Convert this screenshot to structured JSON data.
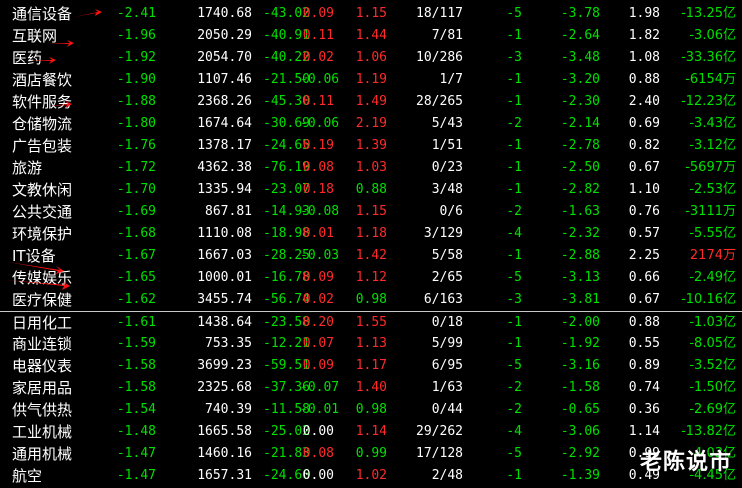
{
  "colors": {
    "up": "#ff2a2a",
    "down": "#00e000",
    "neutral": "#ffffff",
    "background": "#000000"
  },
  "watermark": "老陈说市",
  "rows": [
    {
      "name": "通信设备",
      "change": "-2.41",
      "price": "1740.68",
      "delta": "-43.02",
      "speed": "0.09",
      "ratio": "1.15",
      "updown": "18/117",
      "col7": "-5",
      "col8": "-3.78",
      "col9": "1.98",
      "amount": "-13.25亿",
      "speed_dir": "up",
      "ratio_dir": "up",
      "amount_dir": "down"
    },
    {
      "name": "互联网",
      "change": "-1.96",
      "price": "2050.29",
      "delta": "-40.91",
      "speed": "0.11",
      "ratio": "1.44",
      "updown": "7/81",
      "col7": "-1",
      "col8": "-2.64",
      "col9": "1.82",
      "amount": "-3.06亿",
      "speed_dir": "up",
      "ratio_dir": "up",
      "amount_dir": "down"
    },
    {
      "name": "医药",
      "change": "-1.92",
      "price": "2054.70",
      "delta": "-40.22",
      "speed": "0.02",
      "ratio": "1.06",
      "updown": "10/286",
      "col7": "-3",
      "col8": "-3.48",
      "col9": "1.08",
      "amount": "-33.36亿",
      "speed_dir": "up",
      "ratio_dir": "up",
      "amount_dir": "down"
    },
    {
      "name": "酒店餐饮",
      "change": "-1.90",
      "price": "1107.46",
      "delta": "-21.50",
      "speed": "-0.06",
      "ratio": "1.19",
      "updown": "1/7",
      "col7": "-1",
      "col8": "-3.20",
      "col9": "0.88",
      "amount": "-6154万",
      "speed_dir": "down",
      "ratio_dir": "up",
      "amount_dir": "down"
    },
    {
      "name": "软件服务",
      "change": "-1.88",
      "price": "2368.26",
      "delta": "-45.30",
      "speed": "0.11",
      "ratio": "1.49",
      "updown": "28/265",
      "col7": "-1",
      "col8": "-2.30",
      "col9": "2.40",
      "amount": "-12.23亿",
      "speed_dir": "up",
      "ratio_dir": "up",
      "amount_dir": "down"
    },
    {
      "name": "仓储物流",
      "change": "-1.80",
      "price": "1674.64",
      "delta": "-30.69",
      "speed": "-0.06",
      "ratio": "2.19",
      "updown": "5/43",
      "col7": "-2",
      "col8": "-2.14",
      "col9": "0.69",
      "amount": "-3.43亿",
      "speed_dir": "down",
      "ratio_dir": "up",
      "amount_dir": "down"
    },
    {
      "name": "广告包装",
      "change": "-1.76",
      "price": "1378.17",
      "delta": "-24.65",
      "speed": "0.19",
      "ratio": "1.39",
      "updown": "1/51",
      "col7": "-1",
      "col8": "-2.78",
      "col9": "0.82",
      "amount": "-3.12亿",
      "speed_dir": "up",
      "ratio_dir": "up",
      "amount_dir": "down"
    },
    {
      "name": "旅游",
      "change": "-1.72",
      "price": "4362.38",
      "delta": "-76.19",
      "speed": "0.08",
      "ratio": "1.03",
      "updown": "0/23",
      "col7": "-1",
      "col8": "-2.50",
      "col9": "0.67",
      "amount": "-5697万",
      "speed_dir": "up",
      "ratio_dir": "up",
      "amount_dir": "down"
    },
    {
      "name": "文教休闲",
      "change": "-1.70",
      "price": "1335.94",
      "delta": "-23.07",
      "speed": "0.18",
      "ratio": "0.88",
      "updown": "3/48",
      "col7": "-1",
      "col8": "-2.82",
      "col9": "1.10",
      "amount": "-2.53亿",
      "speed_dir": "up",
      "ratio_dir": "down",
      "amount_dir": "down"
    },
    {
      "name": "公共交通",
      "change": "-1.69",
      "price": "867.81",
      "delta": "-14.93",
      "speed": "-0.08",
      "ratio": "1.15",
      "updown": "0/6",
      "col7": "-2",
      "col8": "-1.63",
      "col9": "0.76",
      "amount": "-3111万",
      "speed_dir": "down",
      "ratio_dir": "up",
      "amount_dir": "down"
    },
    {
      "name": "环境保护",
      "change": "-1.68",
      "price": "1110.08",
      "delta": "-18.98",
      "speed": "0.01",
      "ratio": "1.18",
      "updown": "3/129",
      "col7": "-4",
      "col8": "-2.32",
      "col9": "0.57",
      "amount": "-5.55亿",
      "speed_dir": "up",
      "ratio_dir": "up",
      "amount_dir": "down"
    },
    {
      "name": "IT设备",
      "change": "-1.67",
      "price": "1667.03",
      "delta": "-28.25",
      "speed": "-0.03",
      "ratio": "1.42",
      "updown": "5/58",
      "col7": "-1",
      "col8": "-2.88",
      "col9": "2.25",
      "amount": "2174万",
      "speed_dir": "down",
      "ratio_dir": "up",
      "amount_dir": "up"
    },
    {
      "name": "传媒娱乐",
      "change": "-1.65",
      "price": "1000.01",
      "delta": "-16.78",
      "speed": "0.09",
      "ratio": "1.12",
      "updown": "2/65",
      "col7": "-5",
      "col8": "-3.13",
      "col9": "0.66",
      "amount": "-2.49亿",
      "speed_dir": "up",
      "ratio_dir": "up",
      "amount_dir": "down"
    },
    {
      "name": "医疗保健",
      "change": "-1.62",
      "price": "3455.74",
      "delta": "-56.74",
      "speed": "0.02",
      "ratio": "0.98",
      "updown": "6/163",
      "col7": "-3",
      "col8": "-3.81",
      "col9": "0.67",
      "amount": "-10.16亿",
      "speed_dir": "up",
      "ratio_dir": "down",
      "amount_dir": "down"
    },
    {
      "name": "日用化工",
      "change": "-1.61",
      "price": "1438.64",
      "delta": "-23.58",
      "speed": "0.20",
      "ratio": "1.55",
      "updown": "0/18",
      "col7": "-1",
      "col8": "-2.00",
      "col9": "0.88",
      "amount": "-1.03亿",
      "speed_dir": "up",
      "ratio_dir": "up",
      "amount_dir": "down"
    },
    {
      "name": "商业连锁",
      "change": "-1.59",
      "price": "753.35",
      "delta": "-12.21",
      "speed": "0.07",
      "ratio": "1.13",
      "updown": "5/99",
      "col7": "-1",
      "col8": "-1.92",
      "col9": "0.55",
      "amount": "-8.05亿",
      "speed_dir": "up",
      "ratio_dir": "up",
      "amount_dir": "down"
    },
    {
      "name": "电器仪表",
      "change": "-1.58",
      "price": "3699.23",
      "delta": "-59.51",
      "speed": "0.09",
      "ratio": "1.17",
      "updown": "6/95",
      "col7": "-5",
      "col8": "-3.16",
      "col9": "0.89",
      "amount": "-3.52亿",
      "speed_dir": "up",
      "ratio_dir": "up",
      "amount_dir": "down"
    },
    {
      "name": "家居用品",
      "change": "-1.58",
      "price": "2325.68",
      "delta": "-37.36",
      "speed": "-0.07",
      "ratio": "1.40",
      "updown": "1/63",
      "col7": "-2",
      "col8": "-1.58",
      "col9": "0.74",
      "amount": "-1.50亿",
      "speed_dir": "down",
      "ratio_dir": "up",
      "amount_dir": "down"
    },
    {
      "name": "供气供热",
      "change": "-1.54",
      "price": "740.39",
      "delta": "-11.58",
      "speed": "-0.01",
      "ratio": "0.98",
      "updown": "0/44",
      "col7": "-2",
      "col8": "-0.65",
      "col9": "0.36",
      "amount": "-2.69亿",
      "speed_dir": "down",
      "ratio_dir": "down",
      "amount_dir": "down"
    },
    {
      "name": "工业机械",
      "change": "-1.48",
      "price": "1665.58",
      "delta": "-25.02",
      "speed": "0.00",
      "ratio": "1.14",
      "updown": "29/262",
      "col7": "-4",
      "col8": "-3.06",
      "col9": "1.14",
      "amount": "-13.82亿",
      "speed_dir": "flat",
      "ratio_dir": "up",
      "amount_dir": "down"
    },
    {
      "name": "通用机械",
      "change": "-1.47",
      "price": "1460.16",
      "delta": "-21.83",
      "speed": "0.08",
      "ratio": "0.99",
      "updown": "17/128",
      "col7": "-5",
      "col8": "-2.92",
      "col9": "0.99",
      "amount": "-4.03亿",
      "speed_dir": "up",
      "ratio_dir": "down",
      "amount_dir": "down"
    },
    {
      "name": "航空",
      "change": "-1.47",
      "price": "1657.31",
      "delta": "-24.66",
      "speed": "0.00",
      "ratio": "1.02",
      "updown": "2/48",
      "col7": "-1",
      "col8": "-1.39",
      "col9": "0.49",
      "amount": "-4.45亿",
      "speed_dir": "flat",
      "ratio_dir": "up",
      "amount_dir": "down"
    }
  ]
}
